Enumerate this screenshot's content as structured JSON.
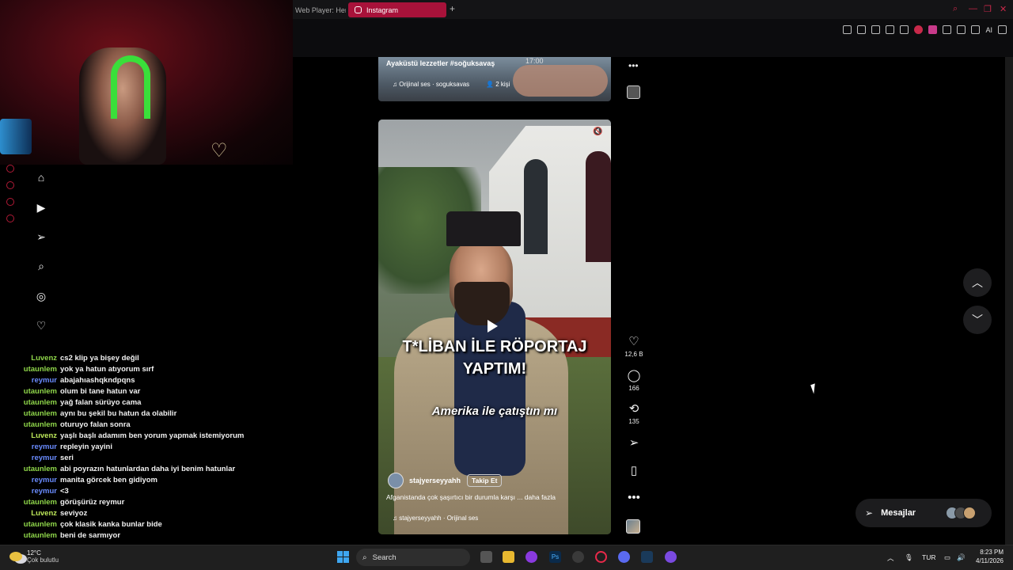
{
  "browser": {
    "tabs": [
      {
        "label": "Web Player: Her...",
        "active": false
      },
      {
        "label": "Instagram",
        "active": true
      }
    ],
    "new_tab": "+",
    "toolbar_ai": "AI"
  },
  "reel_top": {
    "caption": "Ayaküstü lezzetler #soğuksavaş",
    "time": "17:00",
    "audio": "Orijinal ses · soguksavas",
    "people": "2 kişi"
  },
  "reel": {
    "caption_main": "T*LİBAN İLE RÖPORTAJ YAPTIM!",
    "caption_sub": "Amerika ile çatıştın mı",
    "username": "stajyerseyyahh",
    "follow_label": "Takip Et",
    "description": "Afganistanda çok şaşırtıcı bir durumla karşı ... daha fazla",
    "audio": "stajyerseyyahh · Orijinal ses"
  },
  "actions": {
    "likes": "12,6 B",
    "comments": "166",
    "reposts": "135"
  },
  "messages": {
    "label": "Mesajlar"
  },
  "chat": [
    {
      "user": "Luvenz",
      "color": "green",
      "msg": "cs2 klip ya bişey değil"
    },
    {
      "user": "utaunlem",
      "color": "green",
      "msg": "yok ya hatun atıyorum sırf"
    },
    {
      "user": "reymur",
      "color": "blue",
      "msg": "abajahıashqkndpqns"
    },
    {
      "user": "utaunlem",
      "color": "green",
      "msg": "olum bi tane hatun var"
    },
    {
      "user": "utaunlem",
      "color": "green",
      "msg": "yağ falan sürüyo cama"
    },
    {
      "user": "utaunlem",
      "color": "green",
      "msg": "aynı bu şekil bu hatun da olabilir"
    },
    {
      "user": "utaunlem",
      "color": "green",
      "msg": "oturuyo falan sonra"
    },
    {
      "user": "Luvenz",
      "color": "lime",
      "msg": "yaşlı başlı adamım ben yorum yapmak istemiyorum"
    },
    {
      "user": "reymur",
      "color": "blue",
      "msg": "repleyin yayini"
    },
    {
      "user": "reymur",
      "color": "blue",
      "msg": "seri"
    },
    {
      "user": "utaunlem",
      "color": "green",
      "msg": "abi poyrazın hatunlardan daha iyi benim hatunlar"
    },
    {
      "user": "reymur",
      "color": "blue",
      "msg": "manita görcek ben gidiyom"
    },
    {
      "user": "reymur",
      "color": "blue",
      "msg": "<3"
    },
    {
      "user": "utaunlem",
      "color": "green",
      "msg": "görüşürüz reymur"
    },
    {
      "user": "Luvenz",
      "color": "lime",
      "msg": "seviyoz"
    },
    {
      "user": "utaunlem",
      "color": "green",
      "msg": "çok klasik kanka bunlar bide"
    },
    {
      "user": "utaunlem",
      "color": "green",
      "msg": "beni de sarmıyor"
    }
  ],
  "taskbar": {
    "weather_temp": "12°C",
    "weather_cond": "Çok bulutlu",
    "search_label": "Search",
    "language": "TUR",
    "time": "8:23 PM",
    "date": "4/11/2026"
  },
  "colors": {
    "tab_active": "#a8123a",
    "chat_green": "#8fd64a",
    "chat_blue": "#6a8cff",
    "chat_lime": "#bde85a"
  }
}
